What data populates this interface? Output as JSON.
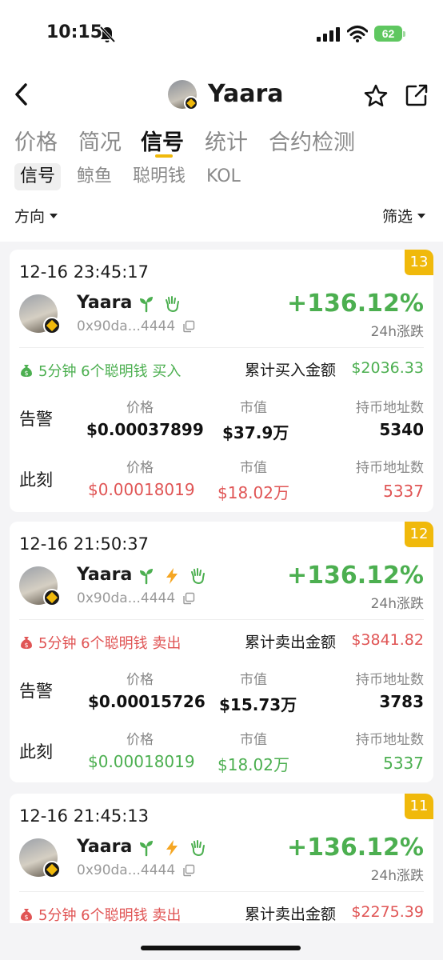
{
  "status_bar": {
    "time": "10:15",
    "battery": "62"
  },
  "header": {
    "title": "Yaara"
  },
  "tabs": [
    {
      "label": "价格"
    },
    {
      "label": "简况"
    },
    {
      "label": "信号"
    },
    {
      "label": "统计"
    },
    {
      "label": "合约检测"
    }
  ],
  "subtabs": [
    {
      "label": "信号"
    },
    {
      "label": "鲸鱼"
    },
    {
      "label": "聪明钱"
    },
    {
      "label": "KOL"
    }
  ],
  "filters": {
    "direction": "方向",
    "screen": "筛选"
  },
  "columns": {
    "price": "价格",
    "mcap": "市值",
    "holders": "持币地址数"
  },
  "rows": {
    "alert": "告警",
    "now": "此刻"
  },
  "cards": [
    {
      "index": "13",
      "time": "12-16 23:45:17",
      "name": "Yaara",
      "address": "0x90da...4444",
      "change": "+136.12%",
      "change_label": "24h涨跌",
      "signal": "5分钟 6个聪明钱 买入",
      "acc_label": "累计买入金额",
      "acc_value": "$2036.33",
      "alert": {
        "price": "$0.00037899",
        "mcap": "$37.9万",
        "holders": "5340"
      },
      "now": {
        "price": "$0.00018019",
        "mcap": "$18.02万",
        "holders": "5337"
      }
    },
    {
      "index": "12",
      "time": "12-16 21:50:37",
      "name": "Yaara",
      "address": "0x90da...4444",
      "change": "+136.12%",
      "change_label": "24h涨跌",
      "signal": "5分钟 6个聪明钱 卖出",
      "acc_label": "累计卖出金额",
      "acc_value": "$3841.82",
      "alert": {
        "price": "$0.00015726",
        "mcap": "$15.73万",
        "holders": "3783"
      },
      "now": {
        "price": "$0.00018019",
        "mcap": "$18.02万",
        "holders": "5337"
      }
    },
    {
      "index": "11",
      "time": "12-16 21:45:13",
      "name": "Yaara",
      "address": "0x90da...4444",
      "change": "+136.12%",
      "change_label": "24h涨跌",
      "signal": "5分钟 6个聪明钱 卖出",
      "acc_label": "累计卖出金额",
      "acc_value": "$2275.39"
    }
  ]
}
